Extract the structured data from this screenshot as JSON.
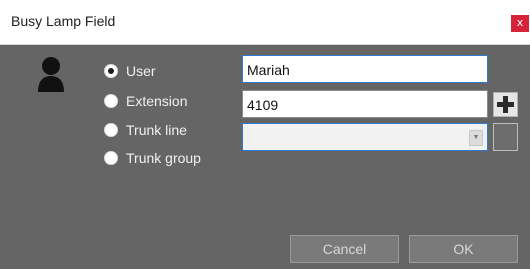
{
  "window": {
    "title": "Busy Lamp Field",
    "close_glyph": "x"
  },
  "radios": [
    {
      "label": "User",
      "checked": true
    },
    {
      "label": "Extension",
      "checked": false
    },
    {
      "label": "Trunk line",
      "checked": false
    },
    {
      "label": "Trunk group",
      "checked": false
    }
  ],
  "fields": {
    "name_value": "Mariah",
    "number_value": "4109",
    "combo_value": ""
  },
  "buttons": {
    "cancel_label": "Cancel",
    "ok_label": "OK"
  },
  "icons": {
    "avatar": "user-icon",
    "add": "plus-icon",
    "dropdown": "chevron-down-icon"
  },
  "colors": {
    "body_bg": "#656565",
    "close_bg": "#d7233a",
    "focus_border": "#2f78d3"
  }
}
